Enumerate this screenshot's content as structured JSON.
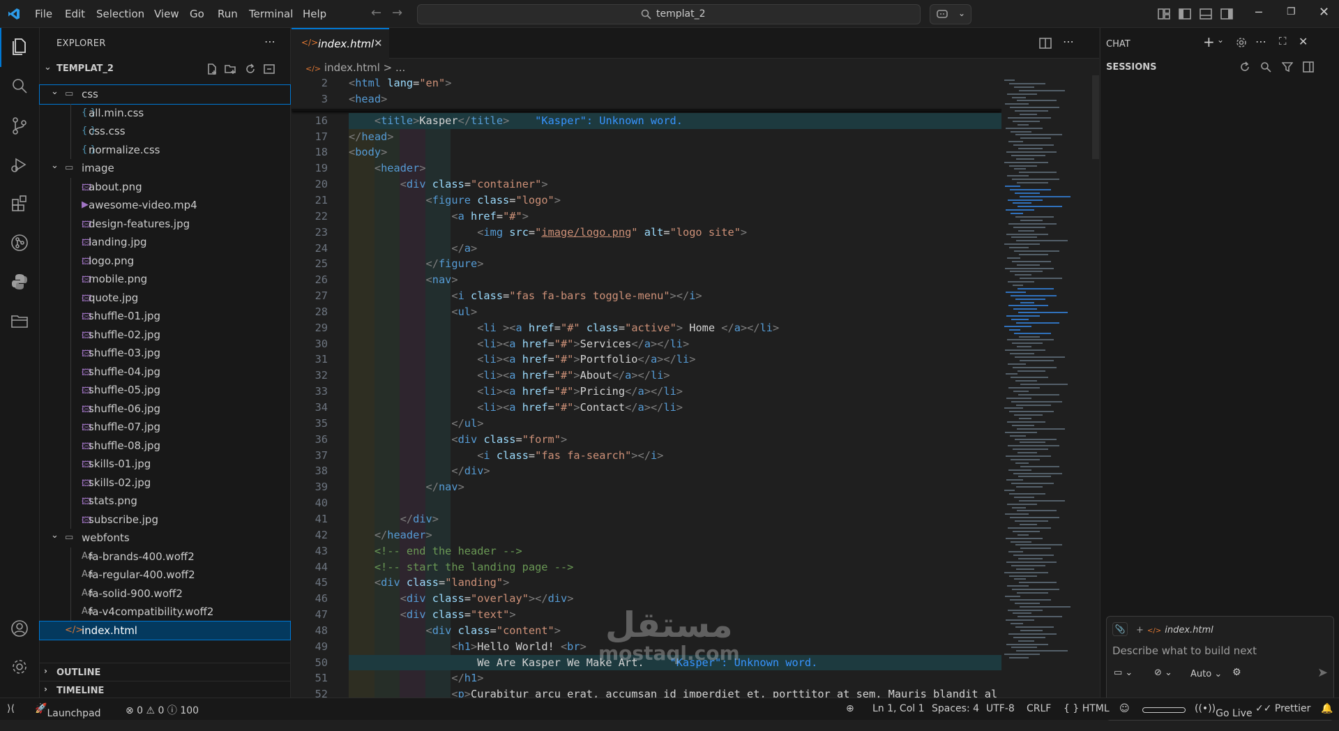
{
  "menu": [
    "File",
    "Edit",
    "Selection",
    "View",
    "Go",
    "Run",
    "Terminal",
    "Help"
  ],
  "command_center": "templat_2",
  "explorer": {
    "title": "EXPLORER",
    "root": "TEMPLAT_2",
    "tree": [
      {
        "type": "folder",
        "label": "css",
        "depth": 0
      },
      {
        "type": "file",
        "label": "all.min.css",
        "depth": 1,
        "icon": "{ }"
      },
      {
        "type": "file",
        "label": "css.css",
        "depth": 1,
        "icon": "{ }"
      },
      {
        "type": "file",
        "label": "normalize.css",
        "depth": 1,
        "icon": "{ }"
      },
      {
        "type": "folder",
        "label": "image",
        "depth": 0
      },
      {
        "type": "file",
        "label": "about.png",
        "depth": 1,
        "icon": "img"
      },
      {
        "type": "file",
        "label": "awesome-video.mp4",
        "depth": 1,
        "icon": "vid"
      },
      {
        "type": "file",
        "label": "design-features.jpg",
        "depth": 1,
        "icon": "img"
      },
      {
        "type": "file",
        "label": "landing.jpg",
        "depth": 1,
        "icon": "img"
      },
      {
        "type": "file",
        "label": "logo.png",
        "depth": 1,
        "icon": "img"
      },
      {
        "type": "file",
        "label": "mobile.png",
        "depth": 1,
        "icon": "img"
      },
      {
        "type": "file",
        "label": "quote.jpg",
        "depth": 1,
        "icon": "img"
      },
      {
        "type": "file",
        "label": "shuffle-01.jpg",
        "depth": 1,
        "icon": "img"
      },
      {
        "type": "file",
        "label": "shuffle-02.jpg",
        "depth": 1,
        "icon": "img"
      },
      {
        "type": "file",
        "label": "shuffle-03.jpg",
        "depth": 1,
        "icon": "img"
      },
      {
        "type": "file",
        "label": "shuffle-04.jpg",
        "depth": 1,
        "icon": "img"
      },
      {
        "type": "file",
        "label": "shuffle-05.jpg",
        "depth": 1,
        "icon": "img"
      },
      {
        "type": "file",
        "label": "shuffle-06.jpg",
        "depth": 1,
        "icon": "img"
      },
      {
        "type": "file",
        "label": "shuffle-07.jpg",
        "depth": 1,
        "icon": "img"
      },
      {
        "type": "file",
        "label": "shuffle-08.jpg",
        "depth": 1,
        "icon": "img"
      },
      {
        "type": "file",
        "label": "skills-01.jpg",
        "depth": 1,
        "icon": "img"
      },
      {
        "type": "file",
        "label": "skills-02.jpg",
        "depth": 1,
        "icon": "img"
      },
      {
        "type": "file",
        "label": "stats.png",
        "depth": 1,
        "icon": "img"
      },
      {
        "type": "file",
        "label": "subscribe.jpg",
        "depth": 1,
        "icon": "img"
      },
      {
        "type": "folder",
        "label": "webfonts",
        "depth": 0
      },
      {
        "type": "file",
        "label": "fa-brands-400.woff2",
        "depth": 1,
        "icon": "Aa"
      },
      {
        "type": "file",
        "label": "fa-regular-400.woff2",
        "depth": 1,
        "icon": "Aa"
      },
      {
        "type": "file",
        "label": "fa-solid-900.woff2",
        "depth": 1,
        "icon": "Aa"
      },
      {
        "type": "file",
        "label": "fa-v4compatibility.woff2",
        "depth": 1,
        "icon": "Aa"
      },
      {
        "type": "file",
        "label": "index.html",
        "depth": 0,
        "icon": "</>",
        "selected": true
      }
    ],
    "outline": "OUTLINE",
    "timeline": "TIMELINE"
  },
  "editor": {
    "tab": "index.html",
    "breadcrumb": "index.html > ...",
    "sticky": [
      {
        "n": "2",
        "html": "<span class='p'>&lt;</span><span class='t'>html</span> <span class='a'>lang</span>=<span class='s'>\"en\"</span><span class='p'>&gt;</span>"
      },
      {
        "n": "3",
        "html": "<span class='p'>&lt;</span><span class='t'>head</span><span class='p'>&gt;</span>"
      }
    ],
    "lines": [
      {
        "n": "16",
        "html": "    <span class='p'>&lt;</span><span class='t'>title</span><span class='p'>&gt;</span>Kasper<span class='p'>&lt;/</span><span class='t'>title</span><span class='p'>&gt;</span>    <span style='color:#3794ff'>\"Kasper\": Unknown word.</span>",
        "hl": true
      },
      {
        "n": "17",
        "html": "<span class='p'>&lt;/</span><span class='t'>head</span><span class='p'>&gt;</span>"
      },
      {
        "n": "18",
        "html": "<span class='p'>&lt;</span><span class='t'>body</span><span class='p'>&gt;</span>"
      },
      {
        "n": "19",
        "html": "    <span class='p'>&lt;</span><span class='t'>header</span><span class='p'>&gt;</span>"
      },
      {
        "n": "20",
        "html": "        <span class='p'>&lt;</span><span class='t'>div</span> <span class='a'>class</span>=<span class='s'>\"container\"</span><span class='p'>&gt;</span>"
      },
      {
        "n": "21",
        "html": "            <span class='p'>&lt;</span><span class='t'>figure</span> <span class='a'>class</span>=<span class='s'>\"logo\"</span><span class='p'>&gt;</span>"
      },
      {
        "n": "22",
        "html": "                <span class='p'>&lt;</span><span class='t'>a</span> <span class='a'>href</span>=<span class='s'>\"#\"</span><span class='p'>&gt;</span>"
      },
      {
        "n": "23",
        "html": "                    <span class='p'>&lt;</span><span class='t'>img</span> <span class='a'>src</span>=<span class='s'>\"<u>image/logo.png</u>\"</span> <span class='a'>alt</span>=<span class='s'>\"logo site\"</span><span class='p'>&gt;</span>"
      },
      {
        "n": "24",
        "html": "                <span class='p'>&lt;/</span><span class='t'>a</span><span class='p'>&gt;</span>"
      },
      {
        "n": "25",
        "html": "            <span class='p'>&lt;/</span><span class='t'>figure</span><span class='p'>&gt;</span>"
      },
      {
        "n": "26",
        "html": "            <span class='p'>&lt;</span><span class='t'>nav</span><span class='p'>&gt;</span>"
      },
      {
        "n": "27",
        "html": "                <span class='p'>&lt;</span><span class='t'>i</span> <span class='a'>class</span>=<span class='s'>\"fas fa-bars toggle-menu\"</span><span class='p'>&gt;&lt;/</span><span class='t'>i</span><span class='p'>&gt;</span>"
      },
      {
        "n": "28",
        "html": "                <span class='p'>&lt;</span><span class='t'>ul</span><span class='p'>&gt;</span>"
      },
      {
        "n": "29",
        "html": "                    <span class='p'>&lt;</span><span class='t'>li</span> <span class='p'>&gt;&lt;</span><span class='t'>a</span> <span class='a'>href</span>=<span class='s'>\"#\"</span> <span class='a'>class</span>=<span class='s'>\"active\"</span><span class='p'>&gt;</span> Home <span class='p'>&lt;/</span><span class='t'>a</span><span class='p'>&gt;&lt;/</span><span class='t'>li</span><span class='p'>&gt;</span>"
      },
      {
        "n": "30",
        "html": "                    <span class='p'>&lt;</span><span class='t'>li</span><span class='p'>&gt;&lt;</span><span class='t'>a</span> <span class='a'>href</span>=<span class='s'>\"#\"</span><span class='p'>&gt;</span>Services<span class='p'>&lt;/</span><span class='t'>a</span><span class='p'>&gt;&lt;/</span><span class='t'>li</span><span class='p'>&gt;</span>"
      },
      {
        "n": "31",
        "html": "                    <span class='p'>&lt;</span><span class='t'>li</span><span class='p'>&gt;&lt;</span><span class='t'>a</span> <span class='a'>href</span>=<span class='s'>\"#\"</span><span class='p'>&gt;</span>Portfolio<span class='p'>&lt;/</span><span class='t'>a</span><span class='p'>&gt;&lt;/</span><span class='t'>li</span><span class='p'>&gt;</span>"
      },
      {
        "n": "32",
        "html": "                    <span class='p'>&lt;</span><span class='t'>li</span><span class='p'>&gt;&lt;</span><span class='t'>a</span> <span class='a'>href</span>=<span class='s'>\"#\"</span><span class='p'>&gt;</span>About<span class='p'>&lt;/</span><span class='t'>a</span><span class='p'>&gt;&lt;/</span><span class='t'>li</span><span class='p'>&gt;</span>"
      },
      {
        "n": "33",
        "html": "                    <span class='p'>&lt;</span><span class='t'>li</span><span class='p'>&gt;&lt;</span><span class='t'>a</span> <span class='a'>href</span>=<span class='s'>\"#\"</span><span class='p'>&gt;</span>Pricing<span class='p'>&lt;/</span><span class='t'>a</span><span class='p'>&gt;&lt;/</span><span class='t'>li</span><span class='p'>&gt;</span>"
      },
      {
        "n": "34",
        "html": "                    <span class='p'>&lt;</span><span class='t'>li</span><span class='p'>&gt;&lt;</span><span class='t'>a</span> <span class='a'>href</span>=<span class='s'>\"#\"</span><span class='p'>&gt;</span>Contact<span class='p'>&lt;/</span><span class='t'>a</span><span class='p'>&gt;&lt;/</span><span class='t'>li</span><span class='p'>&gt;</span>"
      },
      {
        "n": "35",
        "html": "                <span class='p'>&lt;/</span><span class='t'>ul</span><span class='p'>&gt;</span>"
      },
      {
        "n": "36",
        "html": "                <span class='p'>&lt;</span><span class='t'>div</span> <span class='a'>class</span>=<span class='s'>\"form\"</span><span class='p'>&gt;</span>"
      },
      {
        "n": "37",
        "html": "                    <span class='p'>&lt;</span><span class='t'>i</span> <span class='a'>class</span>=<span class='s'>\"fas fa-search\"</span><span class='p'>&gt;&lt;/</span><span class='t'>i</span><span class='p'>&gt;</span>"
      },
      {
        "n": "38",
        "html": "                <span class='p'>&lt;/</span><span class='t'>div</span><span class='p'>&gt;</span>"
      },
      {
        "n": "39",
        "html": "            <span class='p'>&lt;/</span><span class='t'>nav</span><span class='p'>&gt;</span>"
      },
      {
        "n": "40",
        "html": ""
      },
      {
        "n": "41",
        "html": "        <span class='p'>&lt;/</span><span class='t'>div</span><span class='p'>&gt;</span>"
      },
      {
        "n": "42",
        "html": "    <span class='p'>&lt;/</span><span class='t'>header</span><span class='p'>&gt;</span>"
      },
      {
        "n": "43",
        "html": "    <span class='c'>&lt;!-- end the header --&gt;</span>"
      },
      {
        "n": "44",
        "html": "    <span class='c'>&lt;!-- start the landing page --&gt;</span>"
      },
      {
        "n": "45",
        "html": "    <span class='p'>&lt;</span><span class='t'>div</span> <span class='a'>class</span>=<span class='s'>\"landing\"</span><span class='p'>&gt;</span>"
      },
      {
        "n": "46",
        "html": "        <span class='p'>&lt;</span><span class='t'>div</span> <span class='a'>class</span>=<span class='s'>\"overlay\"</span><span class='p'>&gt;&lt;/</span><span class='t'>div</span><span class='p'>&gt;</span>"
      },
      {
        "n": "47",
        "html": "        <span class='p'>&lt;</span><span class='t'>div</span> <span class='a'>class</span>=<span class='s'>\"text\"</span><span class='p'>&gt;</span>"
      },
      {
        "n": "48",
        "html": "            <span class='p'>&lt;</span><span class='t'>div</span> <span class='a'>class</span>=<span class='s'>\"content\"</span><span class='p'>&gt;</span>"
      },
      {
        "n": "49",
        "html": "                <span class='p'>&lt;</span><span class='t'>h1</span><span class='p'>&gt;</span>Hello World! <span class='p'>&lt;</span><span class='t'>br</span><span class='p'>&gt;</span>"
      },
      {
        "n": "50",
        "html": "                    We Are Kasper We Make Art.    <span style='color:#3794ff'>\"Kasper\": Unknown word.</span>",
        "hl": true
      },
      {
        "n": "51",
        "html": "                <span class='p'>&lt;/</span><span class='t'>h1</span><span class='p'>&gt;</span>"
      },
      {
        "n": "52",
        "html": "                <span class='p'>&lt;</span><span class='t'>p</span><span class='p'>&gt;</span>Curabitur arcu erat, accumsan id imperdiet et, porttitor at sem. Mauris blandit al"
      }
    ]
  },
  "chat": {
    "title": "CHAT",
    "sessions": "SESSIONS",
    "attachment": "index.html",
    "placeholder": "Describe what to build next",
    "mode": "Auto"
  },
  "watermark": {
    "arabic": "مستقل",
    "latin": "mostaql.com"
  },
  "status": {
    "launchpad": "Launchpad",
    "problems": "⊗ 0 ⚠ 0 ⓘ 100",
    "position": "Ln 1, Col 1",
    "spaces": "Spaces: 4",
    "encoding": "UTF-8",
    "eol": "CRLF",
    "language": "{ } HTML",
    "golive": "Go Live",
    "prettier": "✓✓ Prettier"
  }
}
